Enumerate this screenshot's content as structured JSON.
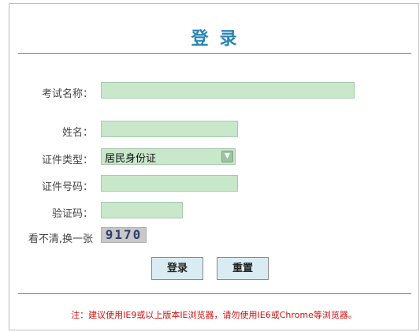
{
  "form": {
    "title": "登录",
    "fields": {
      "exam_name": {
        "label": "考试名称：",
        "value": ""
      },
      "name": {
        "label": "姓名：",
        "value": ""
      },
      "id_type": {
        "label": "证件类型：",
        "selected": "居民身份证"
      },
      "id_number": {
        "label": "证件号码：",
        "value": ""
      },
      "captcha": {
        "label": "验证码：",
        "value": ""
      }
    },
    "captcha_hint": "看不清,换一张",
    "captcha_image_text": "9170",
    "buttons": {
      "login": "登录",
      "reset": "重置"
    },
    "note": "注：建议使用IE9或以上版本IE浏览器，请勿使用IE6或Chrome等浏览器。"
  },
  "colors": {
    "title": "#2a84b4",
    "input_bg": "#c9e7cb",
    "button_bg": "#d9ecf2",
    "note": "#d01010"
  },
  "icons": {
    "select_arrow": "chevron-down-icon"
  }
}
